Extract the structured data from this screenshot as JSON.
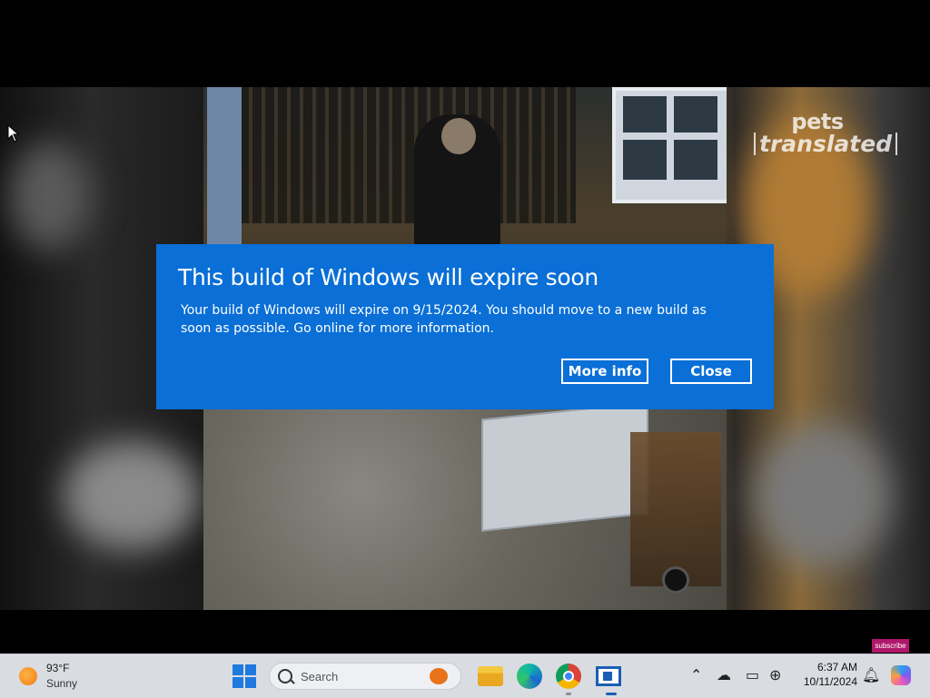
{
  "video": {
    "watermark_line1": "pets",
    "watermark_line2": "translated",
    "subscribe_label": "subscribe"
  },
  "dialog": {
    "title": "This build of Windows will expire soon",
    "body": "Your build of Windows will expire on 9/15/2024. You should move to a new build as soon as possible. Go online for more information.",
    "more_info_label": "More info",
    "close_label": "Close"
  },
  "taskbar": {
    "weather_temp": "93°F",
    "weather_condition": "Sunny",
    "search_placeholder": "Search",
    "clock_time": "6:37 AM",
    "clock_date": "10/11/2024",
    "icons": [
      "weather-sun-icon",
      "windows-start-icon",
      "search-icon",
      "pumpkin-icon",
      "file-explorer-icon",
      "edge-icon",
      "chrome-icon",
      "active-app-icon",
      "chevron-up-icon",
      "onedrive-icon",
      "display-icon",
      "network-icon",
      "bell-icon",
      "copilot-icon"
    ],
    "accent_color": "#0a6fd6"
  }
}
